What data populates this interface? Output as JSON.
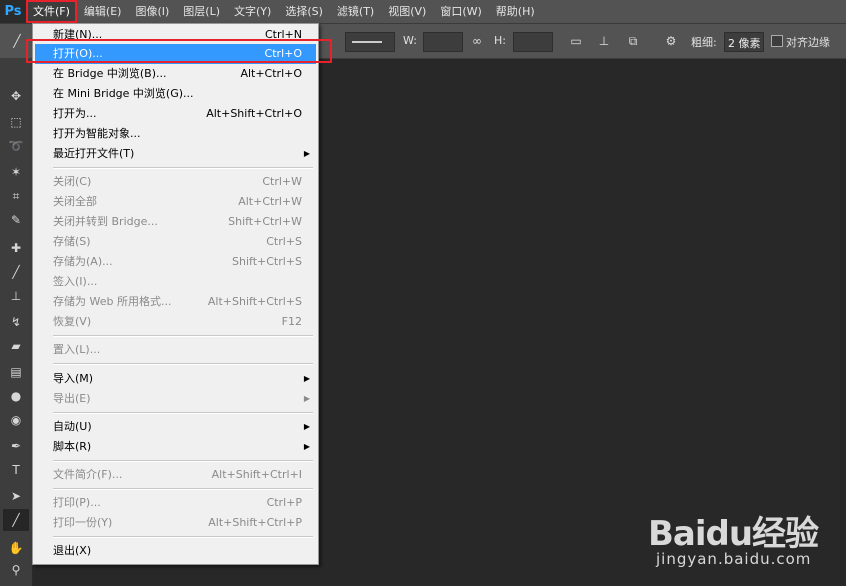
{
  "app": {
    "logo": "Ps"
  },
  "menubar": {
    "items": [
      "文件(F)",
      "编辑(E)",
      "图像(I)",
      "图层(L)",
      "文字(Y)",
      "选择(S)",
      "滤镜(T)",
      "视图(V)",
      "窗口(W)",
      "帮助(H)"
    ]
  },
  "options": {
    "w_label": "W:",
    "h_label": "H:",
    "stroke_label": "粗细:",
    "stroke_value": "2 像素",
    "align_label": "对齐边缘"
  },
  "file_menu": {
    "items": [
      {
        "label": "新建(N)...",
        "shortcut": "Ctrl+N"
      },
      {
        "label": "打开(O)...",
        "shortcut": "Ctrl+O"
      },
      {
        "label": "在 Bridge 中浏览(B)...",
        "shortcut": "Alt+Ctrl+O"
      },
      {
        "label": "在 Mini Bridge 中浏览(G)...",
        "shortcut": ""
      },
      {
        "label": "打开为...",
        "shortcut": "Alt+Shift+Ctrl+O"
      },
      {
        "label": "打开为智能对象...",
        "shortcut": ""
      },
      {
        "label": "最近打开文件(T)",
        "shortcut": ""
      },
      {
        "label": "关闭(C)",
        "shortcut": "Ctrl+W"
      },
      {
        "label": "关闭全部",
        "shortcut": "Alt+Ctrl+W"
      },
      {
        "label": "关闭并转到 Bridge...",
        "shortcut": "Shift+Ctrl+W"
      },
      {
        "label": "存储(S)",
        "shortcut": "Ctrl+S"
      },
      {
        "label": "存储为(A)...",
        "shortcut": "Shift+Ctrl+S"
      },
      {
        "label": "签入(I)...",
        "shortcut": ""
      },
      {
        "label": "存储为 Web 所用格式...",
        "shortcut": "Alt+Shift+Ctrl+S"
      },
      {
        "label": "恢复(V)",
        "shortcut": "F12"
      },
      {
        "label": "置入(L)...",
        "shortcut": ""
      },
      {
        "label": "导入(M)",
        "shortcut": ""
      },
      {
        "label": "导出(E)",
        "shortcut": ""
      },
      {
        "label": "自动(U)",
        "shortcut": ""
      },
      {
        "label": "脚本(R)",
        "shortcut": ""
      },
      {
        "label": "文件简介(F)...",
        "shortcut": "Alt+Shift+Ctrl+I"
      },
      {
        "label": "打印(P)...",
        "shortcut": "Ctrl+P"
      },
      {
        "label": "打印一份(Y)",
        "shortcut": "Alt+Shift+Ctrl+P"
      },
      {
        "label": "退出(X)",
        "shortcut": ""
      }
    ]
  },
  "watermark": {
    "logo": "Baidu经验",
    "url": "jingyan.baidu.com"
  },
  "colors": {
    "highlight": "#3399ff",
    "annotation_red": "#e8222a",
    "ps_blue": "#31a8ff"
  }
}
